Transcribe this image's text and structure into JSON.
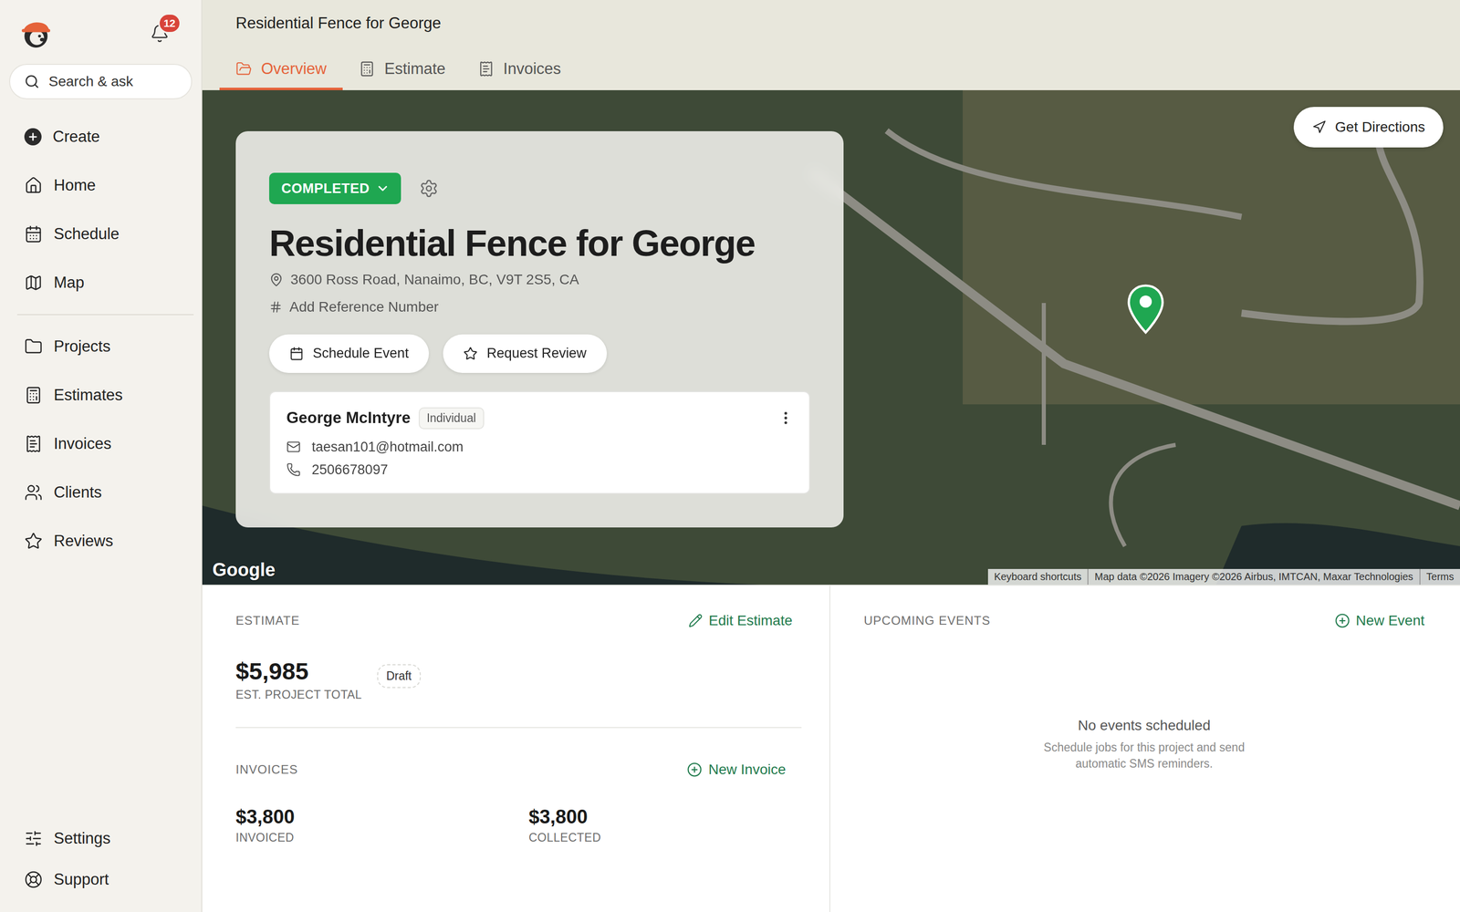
{
  "window": {
    "title": "Residential Fence for George"
  },
  "notifications": {
    "count": "12"
  },
  "search": {
    "placeholder": "Search & ask"
  },
  "sidebar": {
    "primary": [
      {
        "label": "Create"
      },
      {
        "label": "Home"
      },
      {
        "label": "Schedule"
      },
      {
        "label": "Map"
      }
    ],
    "secondary": [
      {
        "label": "Projects"
      },
      {
        "label": "Estimates"
      },
      {
        "label": "Invoices"
      },
      {
        "label": "Clients"
      },
      {
        "label": "Reviews"
      }
    ],
    "footer": [
      {
        "label": "Settings"
      },
      {
        "label": "Support"
      }
    ]
  },
  "tabs": [
    {
      "label": "Overview",
      "selected": true
    },
    {
      "label": "Estimate",
      "selected": false
    },
    {
      "label": "Invoices",
      "selected": false
    }
  ],
  "project": {
    "status": "COMPLETED",
    "title": "Residential Fence for George",
    "address": "3600 Ross Road, Nanaimo, BC, V9T 2S5, CA",
    "reference": "Add Reference Number",
    "actions": [
      "Schedule Event",
      "Request Review"
    ]
  },
  "client": {
    "name": "George McIntyre",
    "type": "Individual",
    "email": "taesan101@hotmail.com",
    "phone": "2506678097"
  },
  "map": {
    "directions": "Get Directions",
    "logo": "Google",
    "attribution": [
      "Keyboard shortcuts",
      "Map data ©2026 Imagery ©2026 Airbus, IMTCAN, Maxar Technologies",
      "Terms"
    ]
  },
  "estimate": {
    "heading": "ESTIMATE",
    "action": "Edit Estimate",
    "amount": "$5,985",
    "label": "EST. PROJECT TOTAL",
    "status": "Draft"
  },
  "invoices": {
    "heading": "INVOICES",
    "action": "New Invoice",
    "stats": [
      {
        "value": "$3,800",
        "label": "INVOICED"
      },
      {
        "value": "$3,800",
        "label": "COLLECTED"
      }
    ]
  },
  "events": {
    "heading": "UPCOMING EVENTS",
    "action": "New Event",
    "empty_title": "No events scheduled",
    "empty_text": "Schedule jobs for this project and send automatic SMS reminders."
  }
}
